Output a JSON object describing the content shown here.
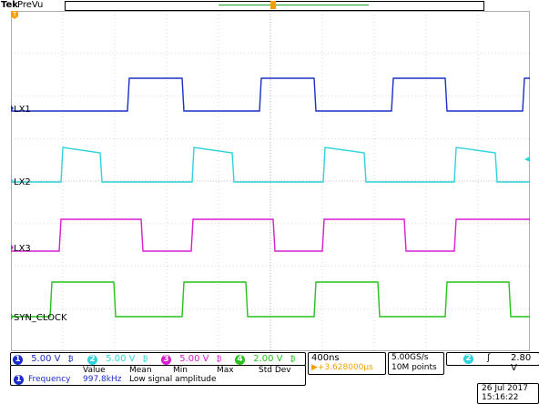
{
  "header": {
    "brand": "Tek",
    "mode": "PreVu"
  },
  "channels": [
    {
      "num": "1",
      "label": "LX1",
      "color": "#1a2ec8",
      "scale": "5.00 V"
    },
    {
      "num": "2",
      "label": "LX2",
      "color": "#2fd3dc",
      "scale": "5.00 V"
    },
    {
      "num": "3",
      "label": "LX3",
      "color": "#d81ccf",
      "scale": "5.00 V"
    },
    {
      "num": "4",
      "label": "SYN_CLOCK",
      "color": "#24c21a",
      "scale": "2.00 V"
    }
  ],
  "bw_symbol": "₿",
  "horizontal": {
    "timebase": "400ns",
    "trigger_offset": "▶+3.628000µs",
    "sample_rate": "5.00GS/s",
    "record": "10M points"
  },
  "trigger": {
    "source": "2",
    "slope": "ʃ",
    "level": "2.80 V"
  },
  "measurement": {
    "headers": [
      "Value",
      "Mean",
      "Min",
      "Max",
      "Std Dev"
    ],
    "channel": "1",
    "name": "Frequency",
    "value": "997.8kHz",
    "note": "Low signal amplitude"
  },
  "datetime": {
    "date": "26 Jul  2017",
    "time": "15:16:22"
  },
  "colors": {
    "trigger_marker": "#f5a000",
    "ch1": "#1a2ec8",
    "ch2": "#2fd3dc",
    "ch3": "#d81ccf",
    "ch4": "#24c21a"
  }
}
